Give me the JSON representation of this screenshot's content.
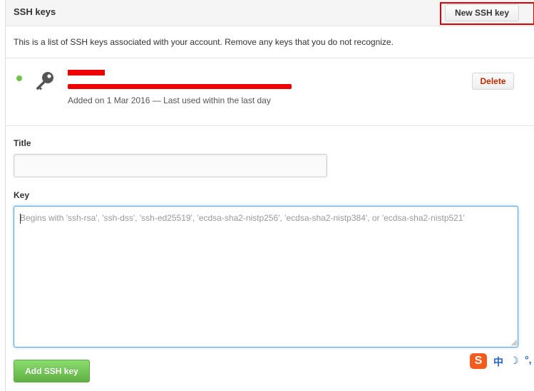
{
  "header": {
    "title": "SSH keys",
    "new_key_label": "New SSH key"
  },
  "intro": {
    "text": "This is a list of SSH keys associated with your account. Remove any keys that you do not recognize."
  },
  "keys": [
    {
      "status": "active",
      "added_text": "Added on 1 Mar 2016 — Last used within the last day",
      "delete_label": "Delete"
    }
  ],
  "form": {
    "title_label": "Title",
    "title_value": "",
    "key_label": "Key",
    "key_placeholder": "Begins with 'ssh-rsa', 'ssh-dss', 'ssh-ed25519', 'ecdsa-sha2-nistp256', 'ecdsa-sha2-nistp384', or 'ecdsa-sha2-nistp521'",
    "submit_label": "Add SSH key"
  },
  "ime": {
    "logo": "S",
    "language": "中",
    "moon": "☽",
    "punct": "°,"
  },
  "colors": {
    "highlight": "#e00000",
    "redaction": "#ee0000",
    "active_dot": "#6cc644",
    "delete_text": "#bd2c00",
    "add_button": "#60b044",
    "focus_border": "#51a7e8",
    "ime_orange": "#f25c1d",
    "ime_blue": "#1e63c4"
  },
  "icons": {
    "key": "key-icon",
    "status": "status-dot",
    "resize": "resize-grip-icon"
  }
}
